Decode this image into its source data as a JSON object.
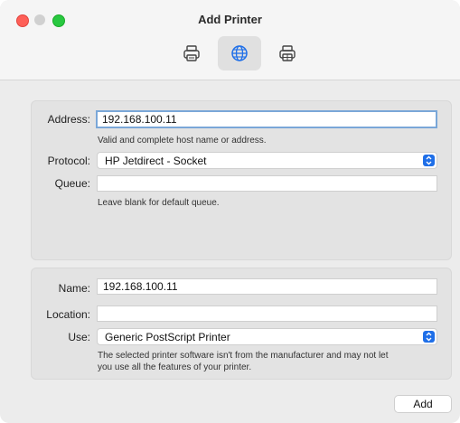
{
  "window": {
    "title": "Add Printer"
  },
  "toolbar": {
    "buttons": [
      {
        "icon": "default-printer-icon"
      },
      {
        "icon": "ip-globe-icon",
        "selected": true
      },
      {
        "icon": "windows-printer-icon"
      }
    ]
  },
  "connection": {
    "address_label": "Address:",
    "address_value": "192.168.100.11",
    "address_hint": "Valid and complete host name or address.",
    "protocol_label": "Protocol:",
    "protocol_value": "HP Jetdirect - Socket",
    "queue_label": "Queue:",
    "queue_value": "",
    "queue_hint": "Leave blank for default queue."
  },
  "details": {
    "name_label": "Name:",
    "name_value": "192.168.100.11",
    "location_label": "Location:",
    "location_value": "",
    "use_label": "Use:",
    "use_value": "Generic PostScript Printer",
    "use_hint_line1": "The selected printer software isn't from the manufacturer and may not let",
    "use_hint_line2": "you use all the features of your printer."
  },
  "footer": {
    "add_label": "Add"
  },
  "colors": {
    "accent": "#1f6fe8",
    "focus_ring": "#7aa7d8"
  }
}
